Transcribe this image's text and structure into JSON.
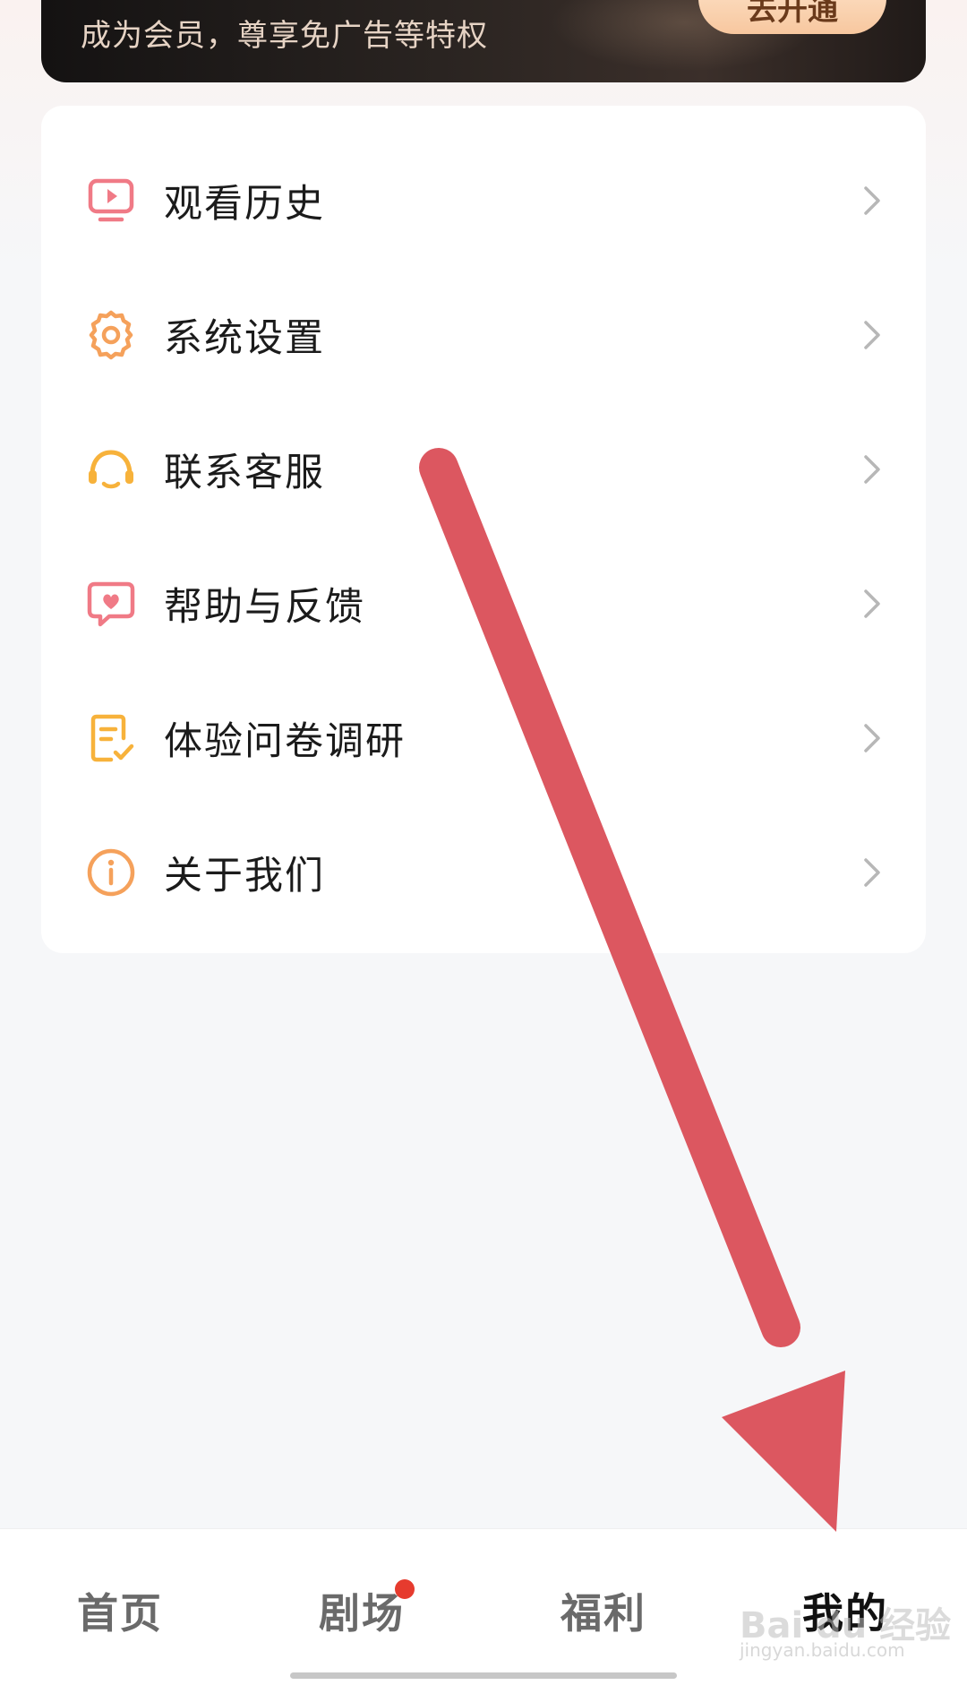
{
  "vip_banner": {
    "subtitle": "成为会员，尊享免广告等特权",
    "button_label": "去开通"
  },
  "menu": {
    "items": [
      {
        "label": "观看历史",
        "icon": "tv-play-icon",
        "color": "#f07a86"
      },
      {
        "label": "系统设置",
        "icon": "gear-icon",
        "color": "#f5a15b"
      },
      {
        "label": "联系客服",
        "icon": "headset-icon",
        "color": "#f7b23b"
      },
      {
        "label": "帮助与反馈",
        "icon": "chat-heart-icon",
        "color": "#f07a86"
      },
      {
        "label": "体验问卷调研",
        "icon": "survey-check-icon",
        "color": "#f7b23b"
      },
      {
        "label": "关于我们",
        "icon": "info-icon",
        "color": "#f5a15b"
      }
    ]
  },
  "bottom_nav": {
    "tabs": [
      {
        "label": "首页",
        "active": false
      },
      {
        "label": "剧场",
        "active": false,
        "badge": true
      },
      {
        "label": "福利",
        "active": false
      },
      {
        "label": "我的",
        "active": true
      }
    ]
  },
  "watermark": {
    "text": "Bai du 经验",
    "sub": "jingyan.baidu.com"
  },
  "colors": {
    "annotation_arrow": "#dc5760",
    "badge": "#e63b2e"
  }
}
